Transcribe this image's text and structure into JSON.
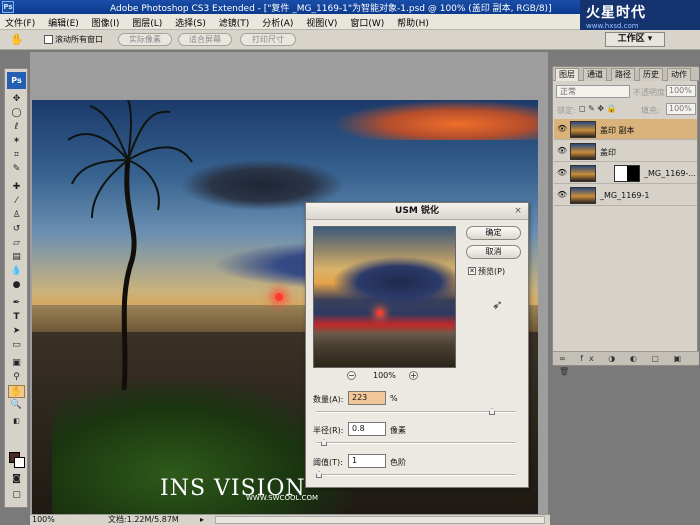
{
  "app": {
    "title": "Adobe Photoshop CS3 Extended - [\"复件 _MG_1169-1\"为智能对象-1.psd @ 100% (盖印 副本, RGB/8)]",
    "logo": "Ps",
    "title_logo": "Ps"
  },
  "brand": {
    "name": "火星时代",
    "url": "www.hxsd.com"
  },
  "menu": [
    "文件(F)",
    "编辑(E)",
    "图像(I)",
    "图层(L)",
    "选择(S)",
    "滤镜(T)",
    "分析(A)",
    "视图(V)",
    "窗口(W)",
    "帮助(H)"
  ],
  "options_bar": {
    "checkbox_label": "滚动所有窗口",
    "buttons": [
      "实际像素",
      "适合屏幕",
      "打印尺寸"
    ],
    "workspace": "工作区 ▾"
  },
  "canvas": {
    "watermark": "INS VISION",
    "watermark_sub": "WWW.SWCOOL.COM"
  },
  "status": {
    "zoom": "100%",
    "doc": "文档:1.22M/5.87M"
  },
  "layers_panel": {
    "tabs": [
      "图层",
      "通道",
      "路径",
      "历史",
      "动作"
    ],
    "blend_mode": "正常",
    "opacity_label": "不透明度:",
    "opacity": "100%",
    "lock_label": "锁定:",
    "fill_label": "填充:",
    "fill": "100%",
    "layers": [
      {
        "name": "盖印 副本",
        "selected": true
      },
      {
        "name": "盖印",
        "selected": false
      },
      {
        "name": "_MG_1169-...",
        "selected": false
      },
      {
        "name": "_MG_1169-1",
        "selected": false
      }
    ],
    "footer_icons": "∞ fx ◑ ◐ ▢ ▣ 🗑"
  },
  "usm_dialog": {
    "title": "USM 锐化",
    "close": "×",
    "ok": "确定",
    "cancel": "取消",
    "preview_label": "预览(P)",
    "zoom_minus": "−",
    "zoom": "100%",
    "zoom_plus": "+",
    "amount_label": "数量(A):",
    "amount": "223",
    "amount_unit": "%",
    "radius_label": "半径(R):",
    "radius": "0.8",
    "radius_unit": "像素",
    "threshold_label": "阈值(T):",
    "threshold": "1",
    "threshold_unit": "色阶"
  },
  "colors": {
    "accent": "#245fb1",
    "selected_layer": "#d9b27c"
  }
}
